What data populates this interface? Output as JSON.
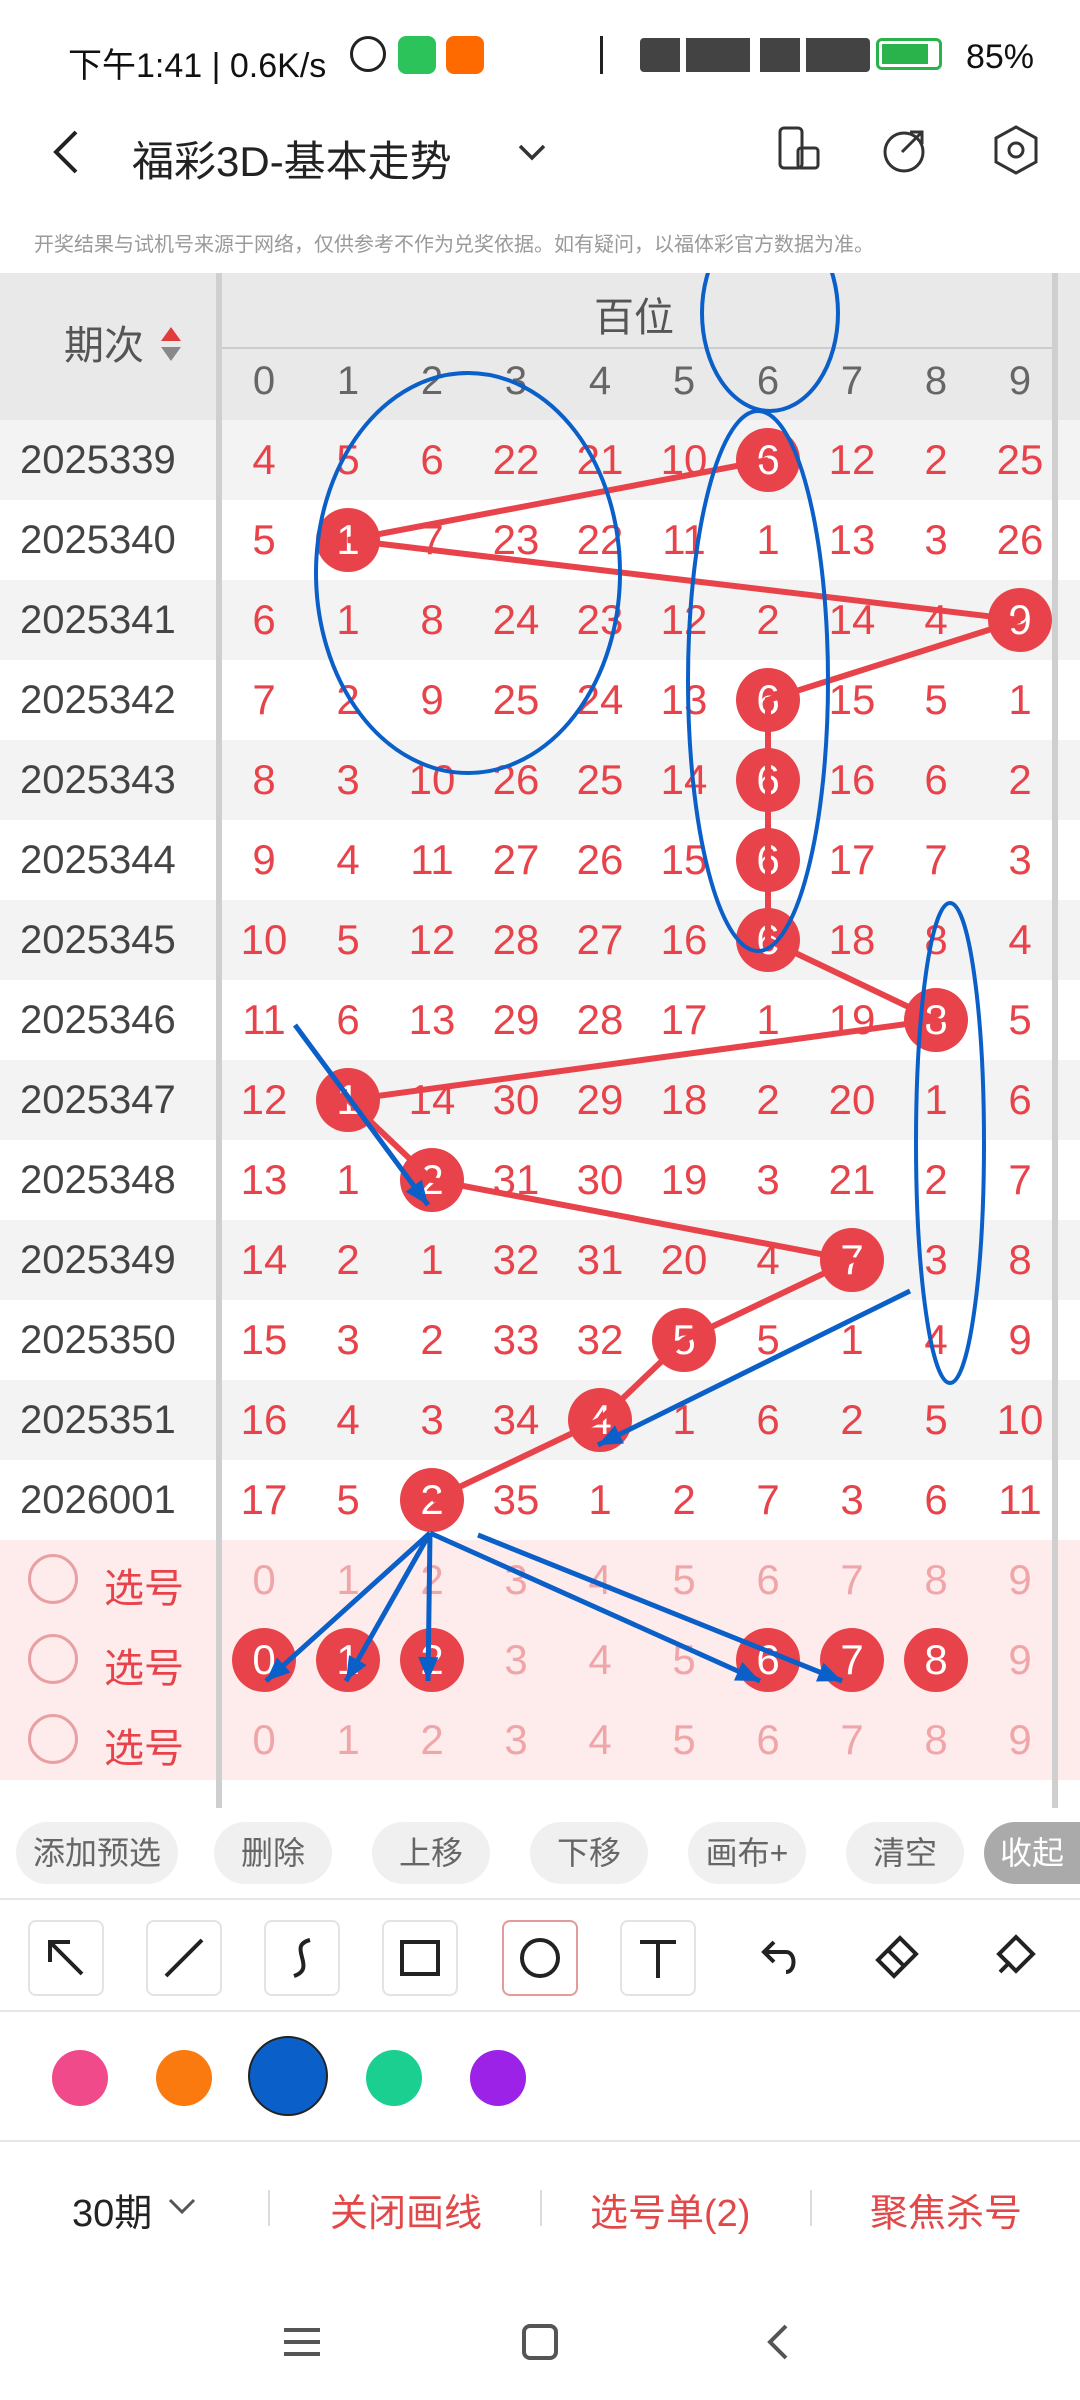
{
  "status": {
    "time": "下午1:41 | 0.6K/s",
    "battery": "85%"
  },
  "header": {
    "title": "福彩3D-基本走势"
  },
  "disclaimer": "开奖结果与试机号来源于网络，仅供参考不作为兑奖依据。如有疑问，以福体彩官方数据为准。",
  "table": {
    "issue_header": "期次",
    "group_header": "百位",
    "digits": [
      "0",
      "1",
      "2",
      "3",
      "4",
      "5",
      "6",
      "7",
      "8",
      "9"
    ],
    "rows": [
      {
        "issue": "2025339",
        "cells": [
          "4",
          "5",
          "6",
          "22",
          "21",
          "10",
          "6",
          "12",
          "2",
          "25"
        ],
        "hit": 6
      },
      {
        "issue": "2025340",
        "cells": [
          "5",
          "1",
          "7",
          "23",
          "22",
          "11",
          "1",
          "13",
          "3",
          "26"
        ],
        "hit": 1
      },
      {
        "issue": "2025341",
        "cells": [
          "6",
          "1",
          "8",
          "24",
          "23",
          "12",
          "2",
          "14",
          "4",
          "9"
        ],
        "hit": 9
      },
      {
        "issue": "2025342",
        "cells": [
          "7",
          "2",
          "9",
          "25",
          "24",
          "13",
          "6",
          "15",
          "5",
          "1"
        ],
        "hit": 6
      },
      {
        "issue": "2025343",
        "cells": [
          "8",
          "3",
          "10",
          "26",
          "25",
          "14",
          "6",
          "16",
          "6",
          "2"
        ],
        "hit": 6
      },
      {
        "issue": "2025344",
        "cells": [
          "9",
          "4",
          "11",
          "27",
          "26",
          "15",
          "6",
          "17",
          "7",
          "3"
        ],
        "hit": 6
      },
      {
        "issue": "2025345",
        "cells": [
          "10",
          "5",
          "12",
          "28",
          "27",
          "16",
          "6",
          "18",
          "8",
          "4"
        ],
        "hit": 6
      },
      {
        "issue": "2025346",
        "cells": [
          "11",
          "6",
          "13",
          "29",
          "28",
          "17",
          "1",
          "19",
          "8",
          "5"
        ],
        "hit": 8
      },
      {
        "issue": "2025347",
        "cells": [
          "12",
          "1",
          "14",
          "30",
          "29",
          "18",
          "2",
          "20",
          "1",
          "6"
        ],
        "hit": 1
      },
      {
        "issue": "2025348",
        "cells": [
          "13",
          "1",
          "2",
          "31",
          "30",
          "19",
          "3",
          "21",
          "2",
          "7"
        ],
        "hit": 2
      },
      {
        "issue": "2025349",
        "cells": [
          "14",
          "2",
          "1",
          "32",
          "31",
          "20",
          "4",
          "7",
          "3",
          "8"
        ],
        "hit": 7
      },
      {
        "issue": "2025350",
        "cells": [
          "15",
          "3",
          "2",
          "33",
          "32",
          "5",
          "5",
          "1",
          "4",
          "9"
        ],
        "hit": 5
      },
      {
        "issue": "2025351",
        "cells": [
          "16",
          "4",
          "3",
          "34",
          "4",
          "1",
          "6",
          "2",
          "5",
          "10"
        ],
        "hit": 4
      },
      {
        "issue": "2026001",
        "cells": [
          "17",
          "5",
          "2",
          "35",
          "1",
          "2",
          "7",
          "3",
          "6",
          "11"
        ],
        "hit": 2
      }
    ],
    "pick_label": "选号",
    "pick_rows": [
      {
        "cells": [
          "0",
          "1",
          "2",
          "3",
          "4",
          "5",
          "6",
          "7",
          "8",
          "9"
        ],
        "selected": []
      },
      {
        "cells": [
          "0",
          "1",
          "2",
          "3",
          "4",
          "5",
          "6",
          "7",
          "8",
          "9"
        ],
        "selected": [
          0,
          1,
          2,
          6,
          7,
          8
        ]
      },
      {
        "cells": [
          "0",
          "1",
          "2",
          "3",
          "4",
          "5",
          "6",
          "7",
          "8",
          "9"
        ],
        "selected": []
      }
    ]
  },
  "actions": {
    "add": "添加预选",
    "delete": "删除",
    "up": "上移",
    "down": "下移",
    "canvas": "画布+",
    "clear": "清空",
    "collapse": "收起"
  },
  "tools": [
    "arrow-tool-icon",
    "line-tool-icon",
    "curve-tool-icon",
    "rectangle-tool-icon",
    "circle-tool-icon",
    "text-tool-icon",
    "undo-icon",
    "eraser-icon",
    "clear-brush-icon"
  ],
  "palette": [
    "#f04a8a",
    "#fb7a0f",
    "#0a5fc8",
    "#1bcf90",
    "#9b22e6"
  ],
  "bottom": {
    "period": "30期",
    "close_lines": "关闭画线",
    "pick_list": "选号单(2)",
    "focus_kill": "聚焦杀号"
  }
}
